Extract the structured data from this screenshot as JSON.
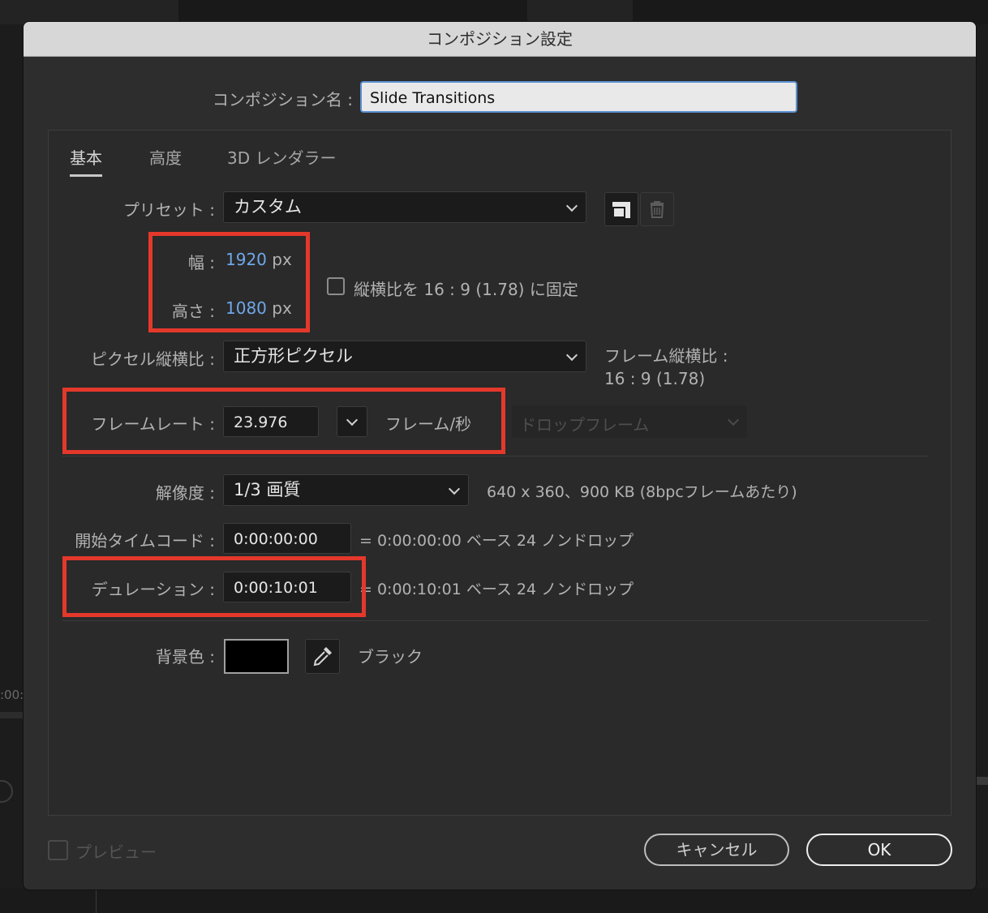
{
  "dialog": {
    "title": "コンポジション設定"
  },
  "comp_name": {
    "label": "コンポジション名 :",
    "value": "Slide Transitions"
  },
  "tabs": [
    {
      "label": "基本",
      "active": true
    },
    {
      "label": "高度",
      "active": false
    },
    {
      "label": "3D レンダラー",
      "active": false
    }
  ],
  "preset": {
    "label": "プリセット :",
    "value": "カスタム",
    "save_icon": "save-preset-icon",
    "delete_icon": "trash-icon"
  },
  "width": {
    "label": "幅 :",
    "value": "1920",
    "unit": "px"
  },
  "height": {
    "label": "高さ :",
    "value": "1080",
    "unit": "px"
  },
  "aspect_lock": {
    "label": "縦横比を 16 : 9 (1.78) に固定",
    "checked": false
  },
  "pixel_aspect": {
    "label": "ピクセル縦横比 :",
    "value": "正方形ピクセル"
  },
  "frame_aspect": {
    "label": "フレーム縦横比 :",
    "value": "16 : 9 (1.78)"
  },
  "frame_rate": {
    "label": "フレームレート :",
    "value": "23.976",
    "unit": "フレーム/秒",
    "drop_frame": "ドロップフレーム"
  },
  "resolution": {
    "label": "解像度 :",
    "value": "1/3 画質",
    "info": "640 x 360、900 KB (8bpcフレームあたり)"
  },
  "start_timecode": {
    "label": "開始タイムコード :",
    "value": "0:00:00:00",
    "info": "= 0:00:00:00  ベース 24  ノンドロップ"
  },
  "duration": {
    "label": "デュレーション :",
    "value": "0:00:10:01",
    "info": "= 0:00:10:01  ベース 24  ノンドロップ"
  },
  "background": {
    "label": "背景色 :",
    "color": "#000000",
    "color_name": "ブラック",
    "eyedropper_icon": "eyedropper-icon"
  },
  "preview": {
    "label": "プレビュー",
    "checked": false
  },
  "buttons": {
    "cancel": "キャンセル",
    "ok": "OK"
  },
  "background_app": {
    "timecode_fragment": ":00:"
  },
  "colors": {
    "highlight_box": "#e4382b",
    "value_blue": "#6ea8ea",
    "dialog_bg": "#2d2d2d"
  }
}
